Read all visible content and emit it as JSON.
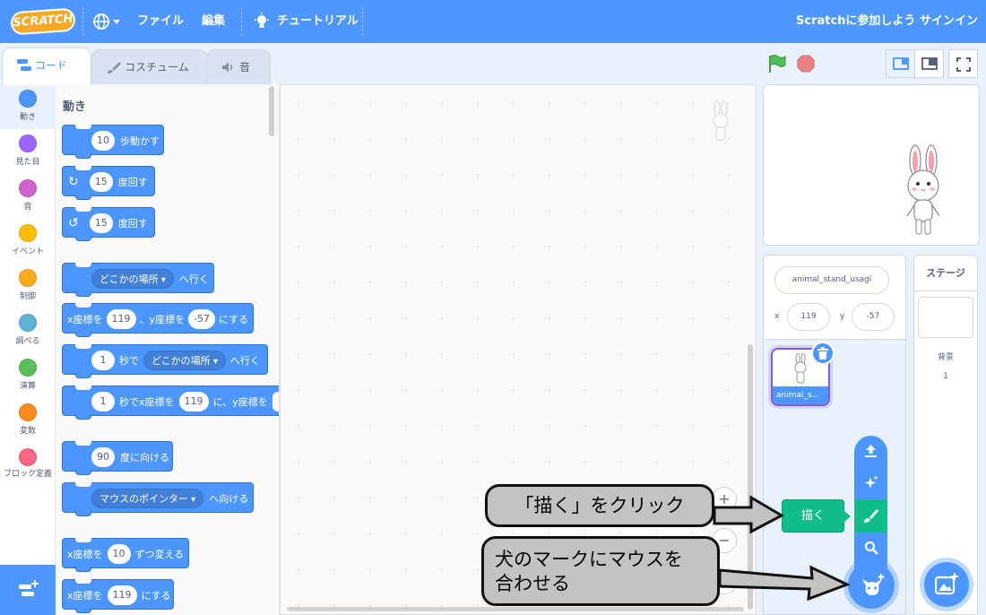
{
  "topbar": {
    "logo": "SCRATCH",
    "file_menu": "ファイル",
    "edit_menu": "編集",
    "tutorials": "チュートリアル",
    "join": "Scratchに参加しよう",
    "signin": "サインイン"
  },
  "tabs": [
    {
      "label": "コード"
    },
    {
      "label": "コスチューム"
    },
    {
      "label": "音"
    }
  ],
  "categories": [
    {
      "label": "動き",
      "color": "#4c97ff"
    },
    {
      "label": "見た目",
      "color": "#9966ff"
    },
    {
      "label": "音",
      "color": "#cf63cf"
    },
    {
      "label": "イベント",
      "color": "#ffbf00"
    },
    {
      "label": "制御",
      "color": "#ffab19"
    },
    {
      "label": "調べる",
      "color": "#5cb1d6"
    },
    {
      "label": "演算",
      "color": "#59c059"
    },
    {
      "label": "変数",
      "color": "#ff8c1a"
    },
    {
      "label": "ブロック定義",
      "color": "#ff6680"
    }
  ],
  "palette": {
    "title": "動き",
    "b1": {
      "val": "10",
      "text": "歩動かす"
    },
    "b2": {
      "val": "15",
      "text": "度回す"
    },
    "b3": {
      "val": "15",
      "text": "度回す"
    },
    "b4": {
      "dd": "どこかの場所",
      "text": "へ行く"
    },
    "b5": {
      "t1": "x座標を",
      "x": "119",
      "t2": "、y座標を",
      "y": "-57",
      "t3": "にする"
    },
    "b6": {
      "val": "1",
      "t1": "秒で",
      "dd": "どこかの場所",
      "t2": "へ行く"
    },
    "b7": {
      "val": "1",
      "t1": "秒でx座標を",
      "x": "119",
      "t2": "に、y座標を"
    },
    "b8": {
      "val": "90",
      "text": "度に向ける"
    },
    "b9": {
      "dd": "マウスのポインター",
      "text": "へ向ける"
    },
    "b10": {
      "t1": "x座標を",
      "val": "10",
      "t2": "ずつ変える"
    },
    "b11": {
      "t1": "x座標を",
      "val": "119",
      "t2": "にする"
    }
  },
  "sprite": {
    "name": "animal_stand_usagi",
    "x_label": "x",
    "x": "119",
    "y_label": "y",
    "y": "-57",
    "tile_name": "animal_s..."
  },
  "stage_panel": {
    "title": "ステージ",
    "backdrop_label": "背景",
    "backdrop_count": "1"
  },
  "menu": {
    "tooltip": "描く"
  },
  "callouts": {
    "paint": "「描く」をクリック",
    "hover_line1": "犬のマークにマウスを",
    "hover_line2": "合わせる"
  }
}
